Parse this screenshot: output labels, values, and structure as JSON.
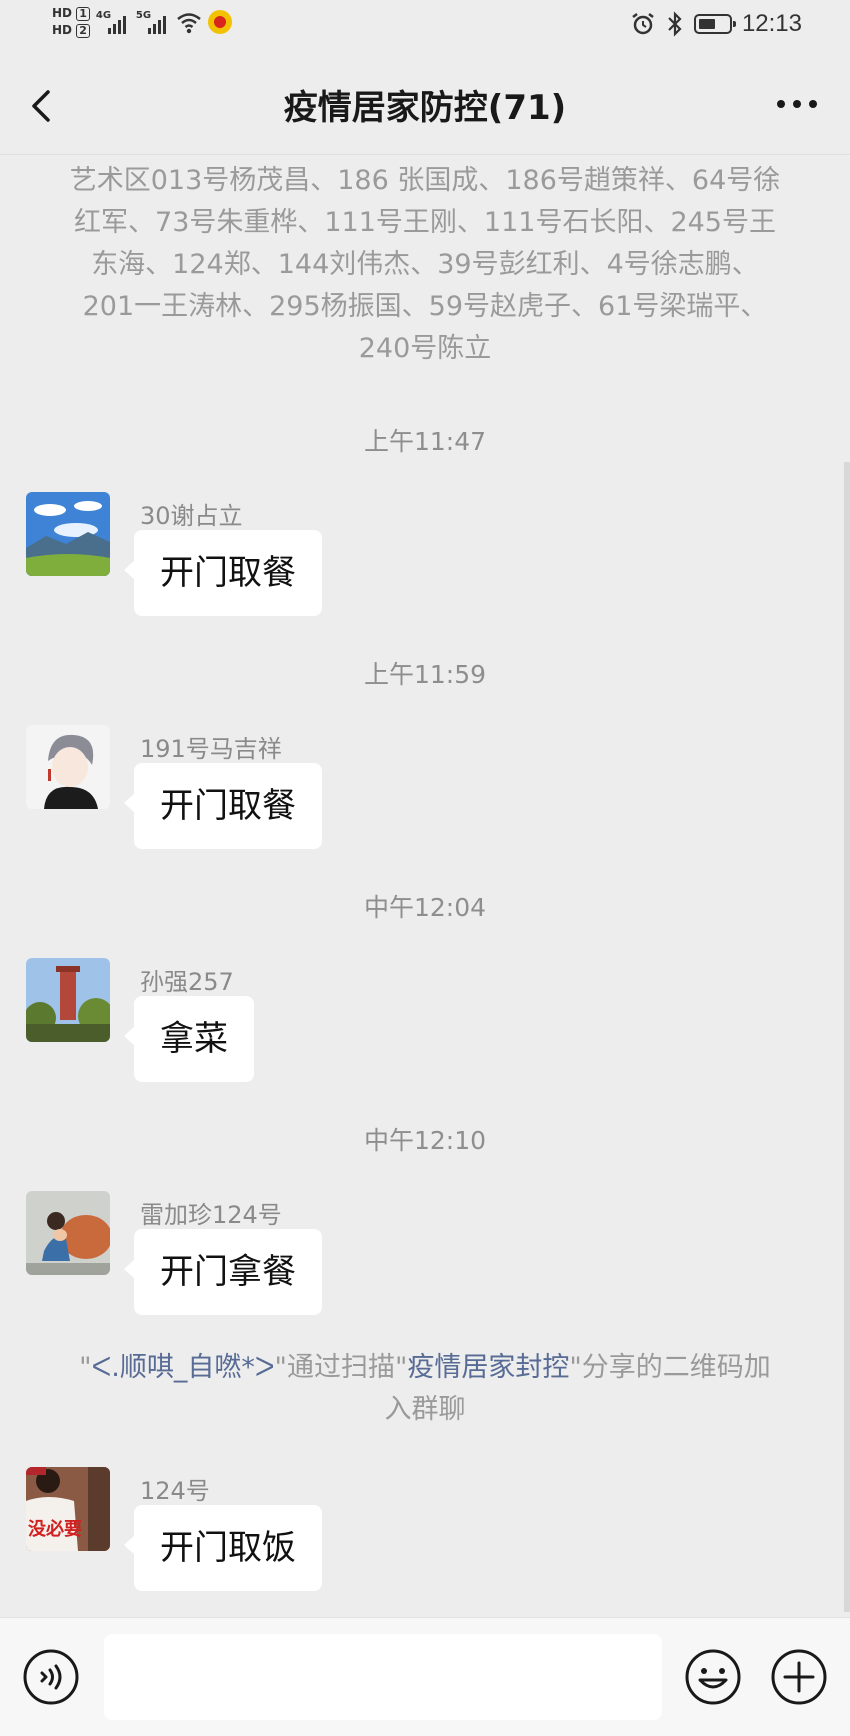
{
  "status_bar": {
    "hd1": "HD",
    "hd1_num": "1",
    "hd2": "HD",
    "hd2_num": "2",
    "net1": "4G",
    "net2": "5G",
    "time": "12:13"
  },
  "nav": {
    "title": "疫情居家防控(71)"
  },
  "system_message": "艺术区013号杨茂昌、186 张国成、186号趙策祥、64号徐红军、73号朱重桦、111号王刚、111号石长阳、245号王东海、124郑、144刘伟杰、39号彭红利、4号徐志鹏、201一王涛林、295杨振国、59号赵虎子、61号梁瑞平、240号陈立",
  "timestamps": [
    "上午11:47",
    "上午11:59",
    "中午12:04",
    "中午12:10"
  ],
  "messages": [
    {
      "sender": "30谢占立",
      "text": "开门取餐"
    },
    {
      "sender": "191号马吉祥",
      "text": "开门取餐"
    },
    {
      "sender": "孙强257",
      "text": "拿菜"
    },
    {
      "sender": "雷加珍124号",
      "text": "开门拿餐"
    },
    {
      "sender": "124号",
      "text": "开门取饭"
    }
  ],
  "join_message": {
    "prefix": "\"",
    "user": "ᐸ.顺唭_自嘫*ᐳ",
    "middle": "\"通过扫描\"",
    "group": "疫情居家封控",
    "suffix": "\"分享的二维码加入群聊"
  },
  "avatar5_text": "没必要",
  "input": {
    "placeholder": ""
  },
  "colors": {
    "background": "#ededed",
    "bubble": "#ffffff",
    "link": "#576b95",
    "meta_text": "#8e8e8e"
  }
}
